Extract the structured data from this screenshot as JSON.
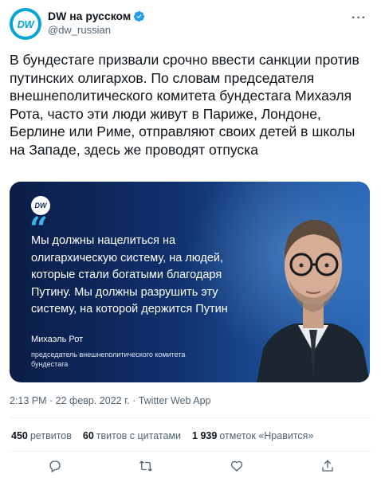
{
  "account": {
    "display_name": "DW на русском",
    "handle": "@dw_russian",
    "avatar_text": "DW"
  },
  "tweet": {
    "text": "В бундестаге призвали срочно ввести санкции против путинских олигархов. По словам председателя внешнеполитического комитета бундестага Михаэля Рота, часто эти люди живут в Париже, Лондоне, Берлине или Риме, отправляют своих детей в школы на Западе, здесь же проводят отпуска"
  },
  "media": {
    "logo_text": "DW",
    "quote_mark": "“",
    "quote": "Мы должны нацелиться на олигархическую систему, на людей, которые стали богатыми благодаря Путину. Мы должны разрушить эту систему, на которой держится Путин",
    "speaker": "Михаэль Рот",
    "speaker_role": "председатель внешнеполитического комитета бундестага"
  },
  "meta": {
    "timestamp": "2:13 PM · 22 февр. 2022 г. · Twitter Web App"
  },
  "stats": {
    "retweets_count": "450",
    "retweets_label": "ретвитов",
    "quotes_count": "60",
    "quotes_label": "твитов с цитатами",
    "likes_count": "1 939",
    "likes_label": "отметок «Нравится»"
  },
  "icons": {
    "more": "more-options-icon",
    "verified": "verified-badge-icon",
    "reply": "reply-icon",
    "retweet": "retweet-icon",
    "like": "heart-icon",
    "share": "share-icon"
  },
  "colors": {
    "accent": "#1d9bf0",
    "dw_blue": "#05a4d6",
    "text": "#0f1419",
    "secondary": "#536471"
  }
}
